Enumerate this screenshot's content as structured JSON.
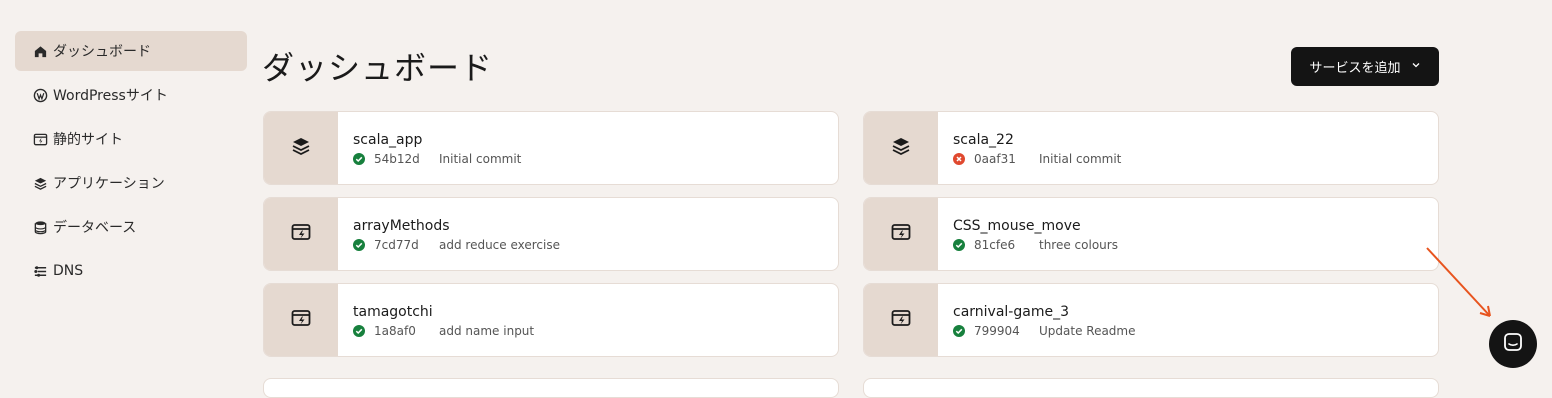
{
  "sidebar": {
    "items": [
      {
        "label": "ダッシュボード",
        "icon": "home-icon",
        "active": true
      },
      {
        "label": "WordPressサイト",
        "icon": "wordpress-icon"
      },
      {
        "label": "静的サイト",
        "icon": "static-site-icon"
      },
      {
        "label": "アプリケーション",
        "icon": "layers-icon"
      },
      {
        "label": "データベース",
        "icon": "database-icon"
      },
      {
        "label": "DNS",
        "icon": "dns-icon"
      }
    ]
  },
  "header": {
    "title": "ダッシュボード",
    "add_service_label": "サービスを追加"
  },
  "cards": [
    {
      "name": "scala_app",
      "hash": "54b12d",
      "message": "Initial commit",
      "status": "success",
      "icon": "layers-icon"
    },
    {
      "name": "scala_22",
      "hash": "0aaf31",
      "message": "Initial commit",
      "status": "failed",
      "icon": "layers-icon"
    },
    {
      "name": "arrayMethods",
      "hash": "7cd77d",
      "message": "add reduce exercise",
      "status": "success",
      "icon": "static-site-icon"
    },
    {
      "name": "CSS_mouse_move",
      "hash": "81cfe6",
      "message": "three colours",
      "status": "success",
      "icon": "static-site-icon"
    },
    {
      "name": "tamagotchi",
      "hash": "1a8af0",
      "message": "add name input",
      "status": "success",
      "icon": "static-site-icon"
    },
    {
      "name": "carnival-game_3",
      "hash": "799904",
      "message": "Update Readme",
      "status": "success",
      "icon": "static-site-icon"
    }
  ],
  "colors": {
    "success": "#17803d",
    "failed": "#e0492f",
    "accent_arrow": "#e8541e"
  }
}
